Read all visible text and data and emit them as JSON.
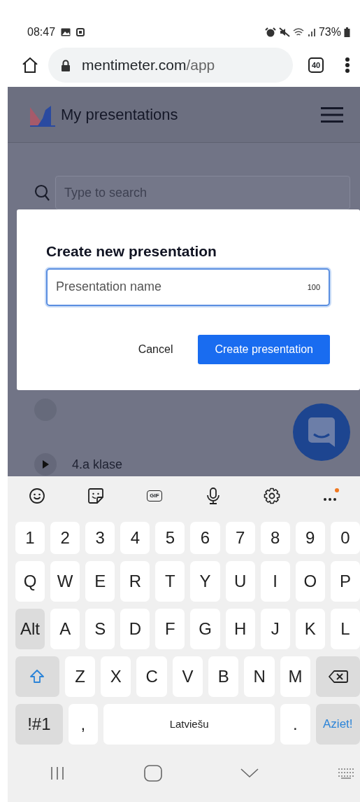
{
  "status_bar": {
    "time": "08:47",
    "battery": "73%"
  },
  "browser": {
    "url_host": "mentimeter.com",
    "url_path": "/app",
    "tab_count": "40"
  },
  "app": {
    "title": "My presentations",
    "search": {
      "placeholder": "Type to search"
    },
    "items": [
      {
        "label": "4.a klase"
      }
    ]
  },
  "dialog": {
    "title": "Create new presentation",
    "name_field": {
      "placeholder": "Presentation name",
      "counter": "100",
      "focused": true
    },
    "buttons": [
      {
        "label": "Cancel",
        "kind": "secondary"
      },
      {
        "label": "Create presentation",
        "kind": "primary"
      }
    ]
  },
  "keyboard": {
    "toolbar": [
      {
        "kind": "emoji"
      },
      {
        "kind": "sticker"
      },
      {
        "kind": "gif",
        "label": "GIF"
      },
      {
        "kind": "mic"
      },
      {
        "kind": "settings"
      },
      {
        "kind": "more",
        "notification": true
      }
    ],
    "key_rows": [
      {
        "keys": [
          {
            "kind": "char",
            "label": "1"
          },
          {
            "kind": "char",
            "label": "2"
          },
          {
            "kind": "char",
            "label": "3"
          },
          {
            "kind": "char",
            "label": "4"
          },
          {
            "kind": "char",
            "label": "5"
          },
          {
            "kind": "char",
            "label": "6"
          },
          {
            "kind": "char",
            "label": "7"
          },
          {
            "kind": "char",
            "label": "8"
          },
          {
            "kind": "char",
            "label": "9"
          },
          {
            "kind": "char",
            "label": "0"
          }
        ]
      },
      {
        "keys": [
          {
            "kind": "char",
            "label": "Q"
          },
          {
            "kind": "char",
            "label": "W"
          },
          {
            "kind": "char",
            "label": "E"
          },
          {
            "kind": "char",
            "label": "R"
          },
          {
            "kind": "char",
            "label": "T"
          },
          {
            "kind": "char",
            "label": "Y"
          },
          {
            "kind": "char",
            "label": "U"
          },
          {
            "kind": "char",
            "label": "I"
          },
          {
            "kind": "char",
            "label": "O"
          },
          {
            "kind": "char",
            "label": "P"
          }
        ]
      },
      {
        "keys": [
          {
            "kind": "alt",
            "label": "Alt"
          },
          {
            "kind": "char",
            "label": "A"
          },
          {
            "kind": "char",
            "label": "S"
          },
          {
            "kind": "char",
            "label": "D"
          },
          {
            "kind": "char",
            "label": "F"
          },
          {
            "kind": "char",
            "label": "G"
          },
          {
            "kind": "char",
            "label": "H"
          },
          {
            "kind": "char",
            "label": "J"
          },
          {
            "kind": "char",
            "label": "K"
          },
          {
            "kind": "char",
            "label": "L"
          }
        ]
      },
      {
        "keys": [
          {
            "kind": "shift"
          },
          {
            "kind": "char",
            "label": "Z"
          },
          {
            "kind": "char",
            "label": "X"
          },
          {
            "kind": "char",
            "label": "C"
          },
          {
            "kind": "char",
            "label": "V"
          },
          {
            "kind": "char",
            "label": "B"
          },
          {
            "kind": "char",
            "label": "N"
          },
          {
            "kind": "char",
            "label": "M"
          },
          {
            "kind": "backspace"
          }
        ]
      },
      {
        "keys": [
          {
            "kind": "symbols",
            "label": "!#1"
          },
          {
            "kind": "char",
            "label": ","
          },
          {
            "kind": "space",
            "label": "Latviešu"
          },
          {
            "kind": "char",
            "label": "."
          },
          {
            "kind": "enter",
            "label": "Aziet!"
          }
        ]
      }
    ]
  }
}
